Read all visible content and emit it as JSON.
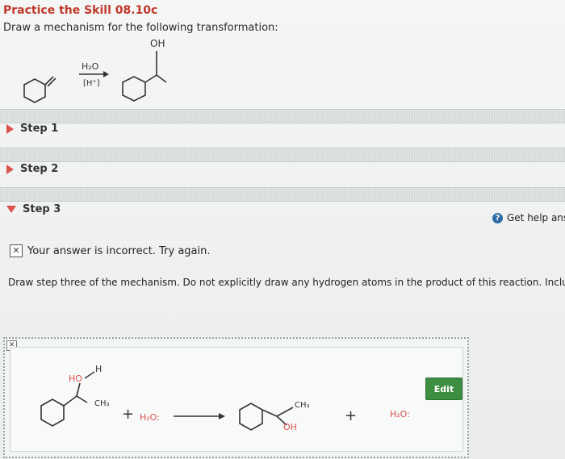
{
  "header": {
    "title": "Practice the Skill 08.10c",
    "instruction": "Draw a mechanism for the following transformation:"
  },
  "scheme": {
    "reagent_top": "H₂O",
    "reagent_bottom": "[H⁺]",
    "product_label": "OH"
  },
  "steps": {
    "step1": "Step 1",
    "step2": "Step 2",
    "step3": "Step 3"
  },
  "help": {
    "label": "Get help answ"
  },
  "feedback": {
    "incorrect": "Your answer is incorrect.  Try again."
  },
  "prompt": {
    "text": "Draw step three of the mechanism. Do not explicitly draw any hydrogen atoms in the product of this reaction. Include lo"
  },
  "answer": {
    "ho_label": "HO",
    "h_label": "H",
    "ch3_left": "CH₃",
    "plus1": "+",
    "water_left": "H₂O:",
    "ch3_right": "CH₃",
    "oh_right": "OH",
    "plus2": "+",
    "water_right": "H₂O:",
    "edit_label": "Edit"
  }
}
